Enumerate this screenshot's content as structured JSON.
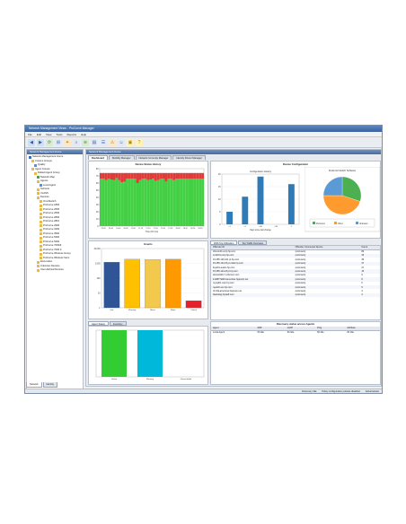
{
  "window": {
    "title": "Network Management Views - ProCurve Manager"
  },
  "menu": [
    "File",
    "Edit",
    "View",
    "Tools",
    "Reports",
    "Help"
  ],
  "nav": {
    "header": "Network Management Home",
    "items": [
      {
        "label": "Network Management Home",
        "depth": 0,
        "color": "#3d6bb3"
      },
      {
        "label": "Custom Groups",
        "depth": 1,
        "color": "#e8b84a"
      },
      {
        "label": "Quality",
        "depth": 2,
        "color": "#5a8fd6"
      },
      {
        "label": "Agent Groups",
        "depth": 1,
        "color": "#e8b84a"
      },
      {
        "label": "Default Agent Group",
        "depth": 2,
        "color": "#e8b84a"
      },
      {
        "label": "Network Map",
        "depth": 3,
        "color": "#4aa34a"
      },
      {
        "label": "Agents",
        "depth": 3,
        "color": "#e8b84a"
      },
      {
        "label": "Local Agent",
        "depth": 4,
        "color": "#5a8fd6"
      },
      {
        "label": "Subnets",
        "depth": 3,
        "color": "#e8b84a"
      },
      {
        "label": "VLANS",
        "depth": 3,
        "color": "#e8b84a"
      },
      {
        "label": "Devices",
        "depth": 3,
        "color": "#e8b84a"
      },
      {
        "label": "OmniSwitch",
        "depth": 4,
        "color": "#e8b84a"
      },
      {
        "label": "ProCurve 1800",
        "depth": 4,
        "color": "#e8b84a"
      },
      {
        "label": "ProCurve 2500",
        "depth": 4,
        "color": "#e8b84a"
      },
      {
        "label": "ProCurve 2600",
        "depth": 4,
        "color": "#e8b84a"
      },
      {
        "label": "ProCurve 2800",
        "depth": 4,
        "color": "#e8b84a"
      },
      {
        "label": "ProCurve 2810",
        "depth": 4,
        "color": "#e8b84a"
      },
      {
        "label": "ProCurve 2900",
        "depth": 4,
        "color": "#e8b84a"
      },
      {
        "label": "ProCurve 3400",
        "depth": 4,
        "color": "#e8b84a"
      },
      {
        "label": "ProCurve 3500",
        "depth": 4,
        "color": "#e8b84a"
      },
      {
        "label": "ProCurve 5300",
        "depth": 4,
        "color": "#e8b84a"
      },
      {
        "label": "ProCurve 5400",
        "depth": 4,
        "color": "#e8b84a"
      },
      {
        "label": "ProCurve 7000dl",
        "depth": 4,
        "color": "#e8b84a"
      },
      {
        "label": "ProCurve 7000 3",
        "depth": 4,
        "color": "#e8b84a"
      },
      {
        "label": "ProCurve Wireless Group",
        "depth": 4,
        "color": "#e8b84a"
      },
      {
        "label": "ProCurve Wireless Servi",
        "depth": 4,
        "color": "#e8b84a"
      },
      {
        "label": "End-nodes",
        "depth": 3,
        "color": "#e8b84a"
      },
      {
        "label": "Unknown Devices",
        "depth": 3,
        "color": "#e8b84a"
      },
      {
        "label": "User-defined Devices",
        "depth": 3,
        "color": "#e8b84a"
      }
    ],
    "tabs": [
      "Network",
      "Identity"
    ]
  },
  "main": {
    "header": "Network Management Home",
    "tabs": [
      "Dashboard",
      "Mobility Manager",
      "Network Immunity Manager",
      "Identity Driven Manager"
    ]
  },
  "panels": {
    "status_history_title": "Device Status History",
    "status_xlabel": "Time (hh:mm)",
    "configuration_title": "Device Configuration",
    "config_history_title": "Configuration History",
    "config_xlabel": "Days since last change",
    "pie_title": "Preferred Switch Software",
    "events_title": "Events",
    "agent_tabs": [
      "Agent Status",
      "Inventory"
    ],
    "traffic_tabs": [
      "DNS Top Offenders",
      "Top Traffic Overview"
    ],
    "discovery_title": "Discovery status across Agents"
  },
  "chart_data": [
    {
      "type": "bar",
      "title": "Device Status History",
      "xlabel": "Time (hh:mm)",
      "ylabel": "",
      "ylim": [
        0,
        80
      ],
      "yticks": [
        0,
        10,
        20,
        30,
        40,
        50,
        60,
        70,
        80
      ],
      "categories": [
        "16:20",
        "16:30",
        "16:40",
        "16:50",
        "17:00",
        "17:10",
        "17:20",
        "17:30",
        "17:40",
        "17:50",
        "18:00",
        "18:10",
        "18:20",
        "18:30"
      ],
      "series": [
        {
          "color": "#44d044",
          "values": [
            66,
            66,
            64,
            66,
            65,
            64,
            67,
            64,
            61,
            62,
            66,
            66,
            66,
            66,
            60,
            64,
            66,
            66,
            64,
            65,
            66,
            63,
            64,
            66,
            66,
            62,
            66,
            66,
            64,
            66,
            66,
            66,
            66,
            66,
            66,
            66,
            66,
            66,
            66,
            66
          ]
        },
        {
          "color": "#e03a3a",
          "values": [
            8,
            8,
            10,
            8,
            9,
            10,
            7,
            10,
            13,
            12,
            8,
            8,
            8,
            8,
            14,
            10,
            8,
            8,
            10,
            9,
            8,
            11,
            10,
            8,
            8,
            12,
            8,
            8,
            10,
            8,
            8,
            8,
            8,
            8,
            8,
            8,
            8,
            8,
            8,
            8
          ]
        }
      ]
    },
    {
      "type": "bar",
      "title": "Configuration History",
      "xlabel": "Days since last change",
      "ylabel": "",
      "ylim": [
        0,
        20
      ],
      "yticks": [
        0,
        5,
        10,
        15,
        20
      ],
      "categories": [
        "<1",
        "<7",
        "<30",
        "<90",
        "-1"
      ],
      "values": [
        5,
        11,
        19,
        0,
        16
      ]
    },
    {
      "type": "pie",
      "title": "Preferred Switch Software",
      "labels": [
        "Preferred",
        "Other",
        "Unknown"
      ],
      "values": [
        30,
        45,
        25
      ],
      "colors": [
        "#4caf50",
        "#ff9a2e",
        "#5b9bd5"
      ]
    },
    {
      "type": "bar",
      "title": "Events",
      "xlabel": "",
      "ylabel": "",
      "ylim": [
        0,
        10000
      ],
      "log": true,
      "yticks": [
        1,
        10,
        100,
        1000,
        10000
      ],
      "ytick_labels": [
        "1",
        "10",
        "100",
        "1,000",
        "10,000"
      ],
      "categories": [
        "Info",
        "Warning",
        "Minor",
        "Major",
        "Critical"
      ],
      "values": [
        1200,
        1900,
        1800,
        1900,
        3
      ],
      "colors": [
        "#2f5597",
        "#ffc000",
        "#f2c94c",
        "#ff9900",
        "#e8202a"
      ]
    },
    {
      "type": "bar",
      "title": "Agent Status",
      "xlabel": "",
      "ylabel": "",
      "ylim": [
        0,
        1
      ],
      "categories": [
        "Online",
        "Warning",
        "Unreachable"
      ],
      "values": [
        1,
        1,
        0
      ],
      "colors": [
        "#33cc33",
        "#00b8d9",
        "#999999"
      ]
    }
  ],
  "offenders": {
    "columns": [
      "Offender ID",
      "Offender Connected Device",
      "Count"
    ],
    "rows": [
      [
        "chicom01.corp.hp.com",
        "(unknown)",
        "89"
      ],
      [
        "smith01.corp.hp.com",
        "(unknown)",
        "43"
      ],
      [
        "15.255.126.101 pt.hp.com",
        "(unknown)",
        "39"
      ],
      [
        "15.255.124.15 pt.mlab.hp.com",
        "(unknown)",
        "37"
      ],
      [
        "lloyd01.austin.hp.com",
        "(unknown)",
        "27"
      ],
      [
        "15.255.124.23 pt.hp.com",
        "(unknown)",
        "15"
      ],
      [
        "ald-ws020-7.coferonc.com",
        "(unknown)",
        "9"
      ],
      [
        "ind0877a904.americas.hpqcorp.net",
        "(unknown)",
        "8"
      ],
      [
        "mysql01.corp.hp.com",
        "(unknown)",
        "6"
      ],
      [
        "neelich.esc.hp.com",
        "(unknown)",
        "5"
      ],
      [
        "dr-04a.americas.hpqcorp.net",
        "(unknown)",
        "4"
      ],
      [
        "blackdog.hpstaff.com",
        "(unknown)",
        "3"
      ]
    ]
  },
  "discovery": {
    "columns": [
      "Agent",
      "ARP",
      "LLDP",
      "Ping",
      "Attribute"
    ],
    "rows": [
      [
        "Local Agent",
        "60 Idle",
        "60 Idle",
        "60 Idle",
        "60 Idle"
      ]
    ]
  },
  "status": {
    "items": [
      "Discovery Idle",
      "Policy configuration policies disabled",
      "Administrator"
    ]
  }
}
